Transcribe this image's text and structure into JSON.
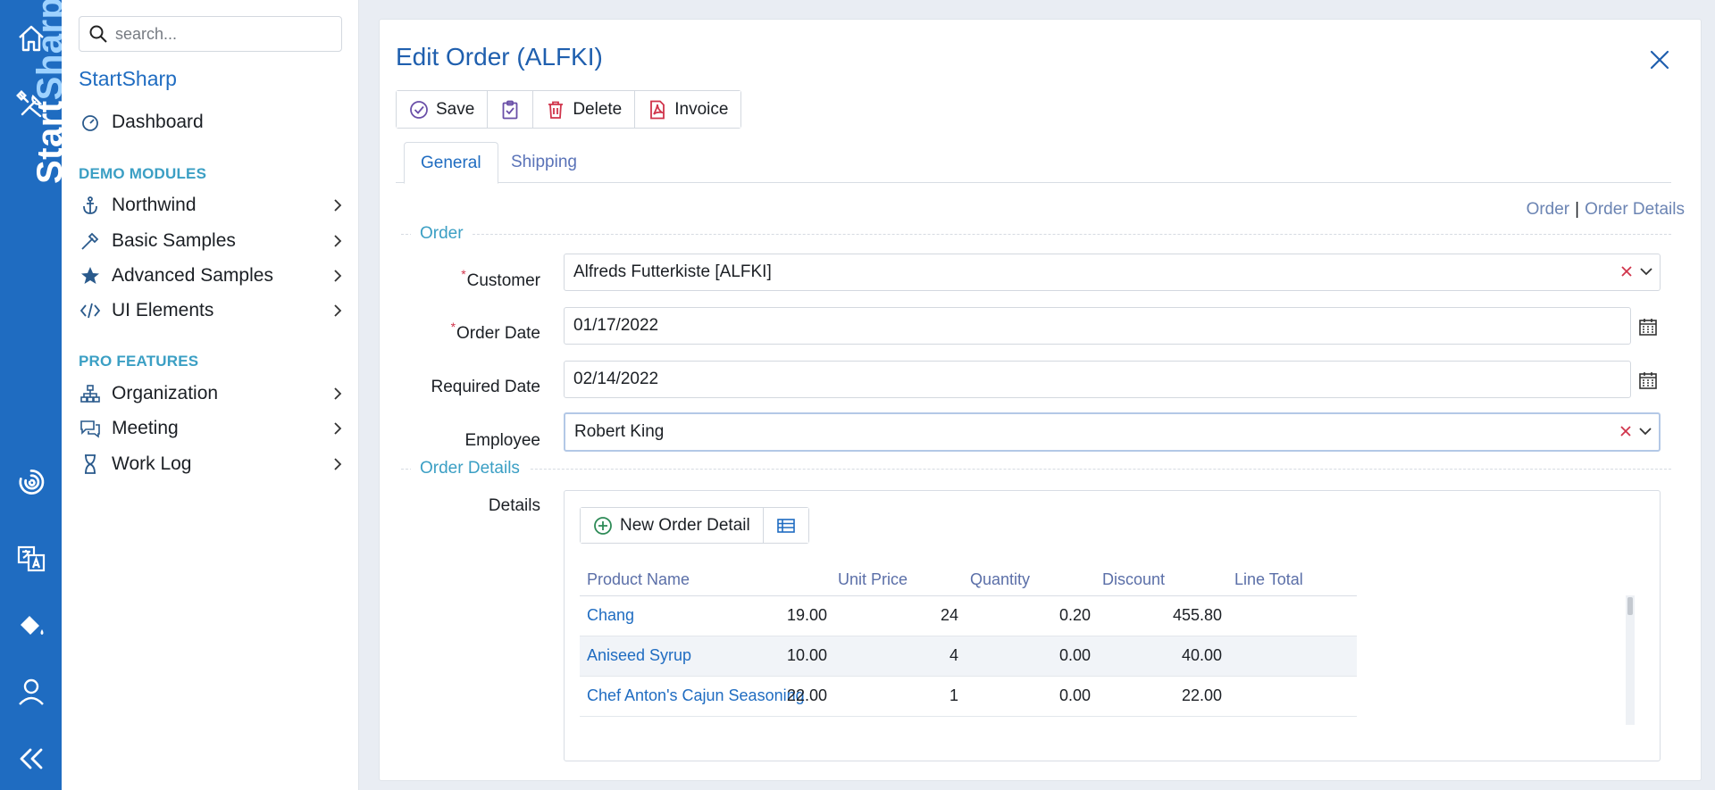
{
  "rail": {
    "brand": {
      "part1": "Start",
      "part2": "Sharp"
    },
    "icons": [
      "home-icon",
      "tools-icon",
      "logo-swirl-icon",
      "translate-icon",
      "paint-bucket-icon",
      "user-icon",
      "collapse-icon"
    ]
  },
  "sidebar": {
    "search_placeholder": "search...",
    "app_title": "StartSharp",
    "dashboard": "Dashboard",
    "demo_header": "DEMO MODULES",
    "demo_items": [
      {
        "label": "Northwind",
        "icon": "anchor-icon"
      },
      {
        "label": "Basic Samples",
        "icon": "magic-wand-icon"
      },
      {
        "label": "Advanced Samples",
        "icon": "star-icon"
      },
      {
        "label": "UI Elements",
        "icon": "code-icon"
      }
    ],
    "pro_header": "PRO FEATURES",
    "pro_items": [
      {
        "label": "Organization",
        "icon": "org-chart-icon"
      },
      {
        "label": "Meeting",
        "icon": "chat-icon"
      },
      {
        "label": "Work Log",
        "icon": "hourglass-icon"
      }
    ]
  },
  "dialog": {
    "title": "Edit Order (ALFKI)",
    "toolbar": {
      "save": "Save",
      "delete": "Delete",
      "invoice": "Invoice"
    },
    "tabs": {
      "general": "General",
      "shipping": "Shipping"
    },
    "anchors": {
      "order": "Order",
      "separator": "|",
      "order_details": "Order Details"
    },
    "section_order": "Order",
    "section_details": "Order Details",
    "fields": {
      "customer": {
        "label": "Customer",
        "value": "Alfreds Futterkiste [ALFKI]",
        "required": "*"
      },
      "order_date": {
        "label": "Order Date",
        "value": "01/17/2022",
        "required": "*"
      },
      "required_date": {
        "label": "Required Date",
        "value": "02/14/2022"
      },
      "employee": {
        "label": "Employee",
        "value": "Robert King"
      }
    },
    "details": {
      "label": "Details",
      "new_button": "New Order Detail",
      "columns": [
        "Product Name",
        "Unit Price",
        "Quantity",
        "Discount",
        "Line Total"
      ],
      "rows": [
        {
          "product": "Chang",
          "unit_price": "19.00",
          "quantity": "24",
          "discount": "0.20",
          "line_total": "455.80"
        },
        {
          "product": "Aniseed Syrup",
          "unit_price": "10.00",
          "quantity": "4",
          "discount": "0.00",
          "line_total": "40.00"
        },
        {
          "product": "Chef Anton's Cajun Seasoning",
          "unit_price": "22.00",
          "quantity": "1",
          "discount": "0.00",
          "line_total": "22.00"
        }
      ]
    }
  },
  "colors": {
    "rail": "#1f6cc1",
    "accent": "#1f6cc1",
    "section": "#3b9fc4",
    "danger": "#d0344b"
  }
}
